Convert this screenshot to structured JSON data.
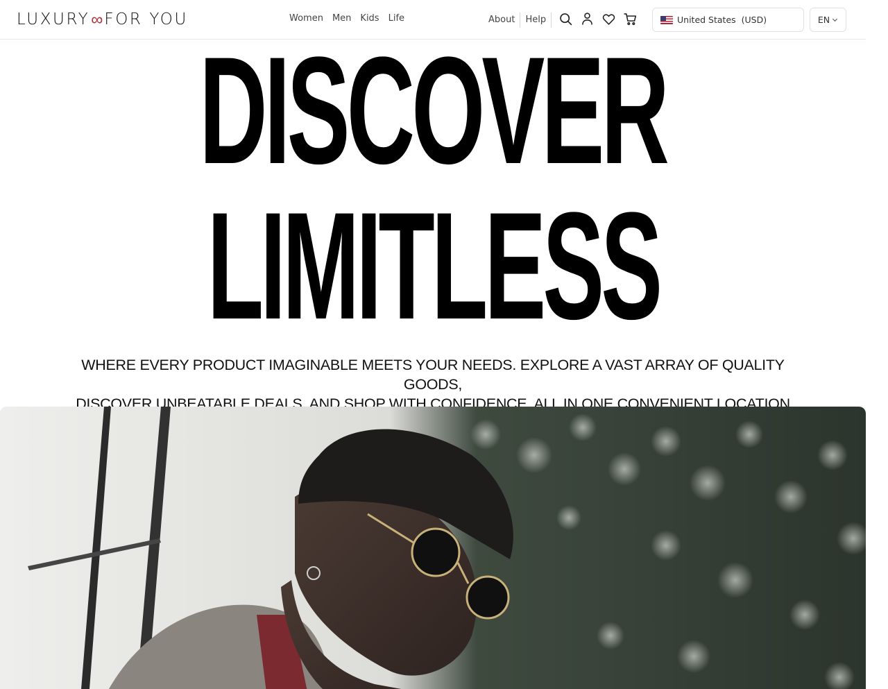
{
  "brand": {
    "left": "LUXURY",
    "symbol": "∞",
    "right": "FOR YOU",
    "accent_color": "#b0303a"
  },
  "nav": {
    "items": [
      "Women",
      "Men",
      "Kids",
      "Life"
    ]
  },
  "utility": {
    "links": [
      "About",
      "Help"
    ]
  },
  "icons": [
    "search-icon",
    "account-icon",
    "wishlist-heart-icon",
    "cart-icon"
  ],
  "locale": {
    "country": "United States",
    "currency": "(USD)",
    "language": "EN"
  },
  "hero": {
    "line1": "DISCOVER",
    "line2": "LIMITLESS",
    "tagline_line1": "WHERE EVERY PRODUCT IMAGINABLE MEETS YOUR NEEDS. EXPLORE A VAST ARRAY OF QUALITY GOODS,",
    "tagline_line2": "DISCOVER UNBEATABLE DEALS, AND SHOP WITH CONFIDENCE, ALL IN ONE CONVENIENT LOCATION"
  }
}
